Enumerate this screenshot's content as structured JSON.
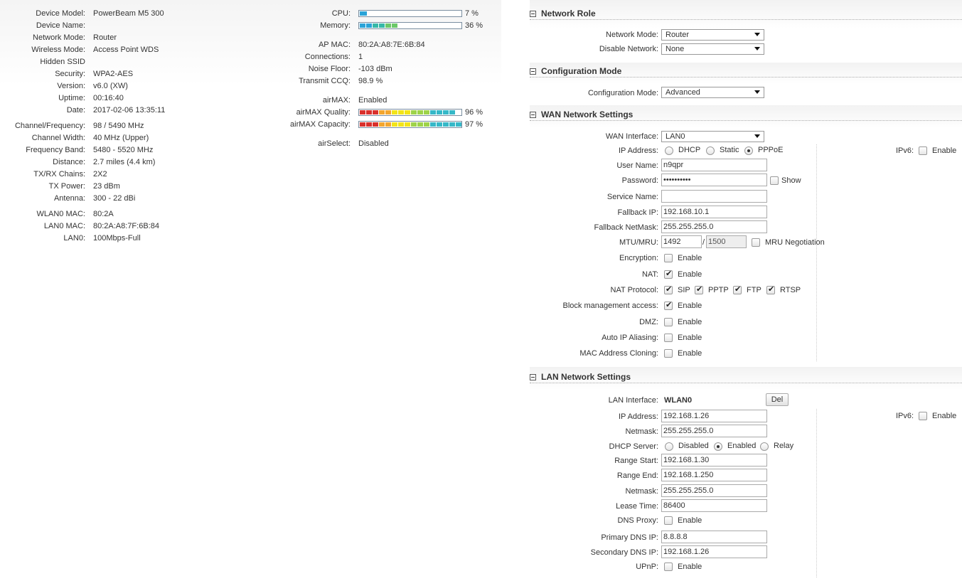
{
  "status": {
    "left_rows": [
      {
        "label": "Device Model:",
        "value": "PowerBeam M5 300"
      },
      {
        "label": "Device Name:",
        "value": ""
      },
      {
        "label": "Network Mode:",
        "value": "Router"
      },
      {
        "label": "Wireless Mode:",
        "value": "Access Point WDS"
      },
      {
        "label": "Hidden SSID",
        "value": ""
      },
      {
        "label": "Security:",
        "value": "WPA2-AES"
      },
      {
        "label": "Version:",
        "value": "v6.0 (XW)"
      },
      {
        "label": "Uptime:",
        "value": "00:16:40"
      },
      {
        "label": "Date:",
        "value": "2017-02-06 13:35:11"
      },
      {
        "label": "Channel/Frequency:",
        "value": "98 / 5490 MHz"
      },
      {
        "label": "Channel Width:",
        "value": "40 MHz (Upper)"
      },
      {
        "label": "Frequency Band:",
        "value": "5480 - 5520 MHz"
      },
      {
        "label": "Distance:",
        "value": "2.7 miles (4.4 km)"
      },
      {
        "label": "TX/RX Chains:",
        "value": "2X2"
      },
      {
        "label": "TX Power:",
        "value": "23 dBm"
      },
      {
        "label": "Antenna:",
        "value": "300 - 22 dBi"
      },
      {
        "label": "WLAN0 MAC:",
        "value": "80:2A"
      },
      {
        "label": "LAN0 MAC:",
        "value": "80:2A:A8:7F:6B:84"
      },
      {
        "label": "LAN0:",
        "value": "100Mbps-Full"
      }
    ],
    "cpu": {
      "label": "CPU:",
      "value": "7 %",
      "level": 7
    },
    "memory": {
      "label": "Memory:",
      "value": "36 %",
      "level": 36
    },
    "mid_rows": [
      {
        "label": "AP MAC:",
        "value": "80:2A:A8:7E:6B:84"
      },
      {
        "label": "Connections:",
        "value": "1"
      },
      {
        "label": "Noise Floor:",
        "value": "-103 dBm"
      },
      {
        "label": "Transmit CCQ:",
        "value": "98.9 %"
      },
      {
        "label": "airMAX:",
        "value": "Enabled"
      }
    ],
    "airmax_quality": {
      "label": "airMAX Quality:",
      "value": "96 %",
      "level": 96
    },
    "airmax_capacity": {
      "label": "airMAX Capacity:",
      "value": "97 %",
      "level": 97
    },
    "airselect": {
      "label": "airSelect:",
      "value": "Disabled"
    }
  },
  "network_role": {
    "title": "Network Role",
    "network_mode_label": "Network Mode:",
    "network_mode_value": "Router",
    "disable_network_label": "Disable Network:",
    "disable_network_value": "None"
  },
  "configuration_mode": {
    "title": "Configuration Mode",
    "label": "Configuration Mode:",
    "value": "Advanced"
  },
  "wan": {
    "title": "WAN Network Settings",
    "interface_label": "WAN Interface:",
    "interface_value": "LAN0",
    "ip_address_label": "IP Address:",
    "ip_options": [
      "DHCP",
      "Static",
      "PPPoE"
    ],
    "ip_selected": "PPPoE",
    "ipv6_label": "IPv6:",
    "ipv6_enable": "Enable",
    "username_label": "User Name:",
    "username_value": "n9qpr",
    "password_label": "Password:",
    "password_value": "••••••••••",
    "show_label": "Show",
    "service_name_label": "Service Name:",
    "service_name_value": "",
    "fallback_ip_label": "Fallback IP:",
    "fallback_ip_value": "192.168.10.1",
    "fallback_netmask_label": "Fallback NetMask:",
    "fallback_netmask_value": "255.255.255.0",
    "mtu_label": "MTU/MRU:",
    "mtu_value": "1492",
    "mtu_sep": "/",
    "mru_value": "1500",
    "mru_negotiation": "MRU Negotiation",
    "encryption_label": "Encryption:",
    "nat_label": "NAT:",
    "nat_protocol_label": "NAT Protocol:",
    "nat_protocols": [
      "SIP",
      "PPTP",
      "FTP",
      "RTSP"
    ],
    "block_mgmt_label": "Block management access:",
    "dmz_label": "DMZ:",
    "auto_ip_label": "Auto IP Aliasing:",
    "mac_clone_label": "MAC Address Cloning:",
    "enable": "Enable"
  },
  "lan": {
    "title": "LAN Network Settings",
    "interface_label": "LAN Interface:",
    "interface_value": "WLAN0",
    "del_button": "Del",
    "ip_address_label": "IP Address:",
    "ip_address_value": "192.168.1.26",
    "ipv6_label": "IPv6:",
    "ipv6_enable": "Enable",
    "netmask_label": "Netmask:",
    "netmask_value": "255.255.255.0",
    "dhcp_server_label": "DHCP Server:",
    "dhcp_options": [
      "Disabled",
      "Enabled",
      "Relay"
    ],
    "dhcp_selected": "Enabled",
    "range_start_label": "Range Start:",
    "range_start_value": "192.168.1.30",
    "range_end_label": "Range End:",
    "range_end_value": "192.168.1.250",
    "netmask2_label": "Netmask:",
    "netmask2_value": "255.255.255.0",
    "lease_time_label": "Lease Time:",
    "lease_time_value": "86400",
    "dns_proxy_label": "DNS Proxy:",
    "primary_dns_label": "Primary DNS IP:",
    "primary_dns_value": "8.8.8.8",
    "secondary_dns_label": "Secondary DNS IP:",
    "secondary_dns_value": "192.168.1.26",
    "upnp_label": "UPnP:",
    "enable": "Enable"
  },
  "colors": {
    "cpu_bar": "#2aa3d8",
    "quality_gradient": [
      "#d9302c",
      "#f3a62e",
      "#f2e418",
      "#9ed34a",
      "#36b8c8"
    ]
  }
}
